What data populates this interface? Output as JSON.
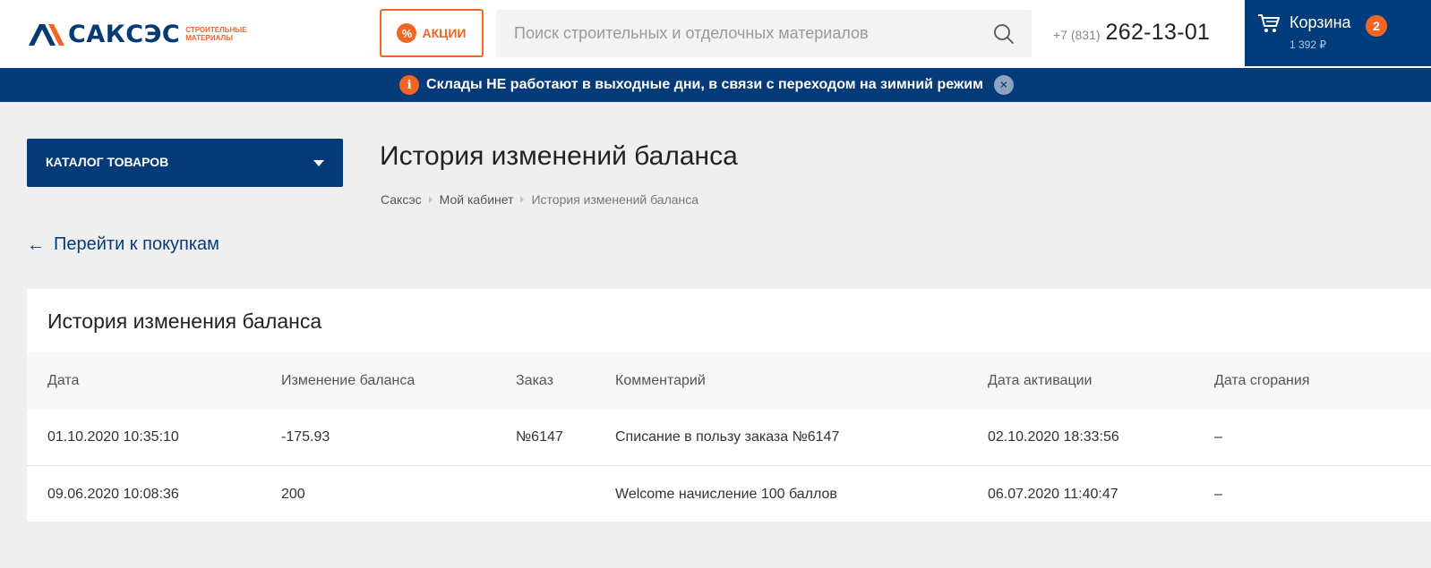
{
  "header": {
    "logo_text": "САКСЭС",
    "logo_sub_line1": "СТРОИТЕЛЬНЫЕ",
    "logo_sub_line2": "МАТЕРИАЛЫ",
    "promo_label": "АКЦИИ",
    "search_placeholder": "Поиск строительных и отделочных материалов",
    "phone_code": "+7 (831)",
    "phone_number": "262-13-01",
    "cart_label": "Корзина",
    "cart_count": "2",
    "cart_sum": "1 392 ₽"
  },
  "notice": {
    "text": "Склады НЕ работают в выходные дни, в связи с переходом на зимний режим"
  },
  "catalog_label": "КАТАЛОГ ТОВАРОВ",
  "page": {
    "title": "История изменений баланса",
    "breadcrumb": [
      "Саксэс",
      "Мой кабинет",
      "История изменений баланса"
    ],
    "back_link": "Перейти к покупкам"
  },
  "table": {
    "title": "История изменения баланса",
    "columns": [
      "Дата",
      "Изменение баланса",
      "Заказ",
      "Комментарий",
      "Дата активации",
      "Дата сгорания"
    ],
    "rows": [
      [
        "01.10.2020 10:35:10",
        "-175.93",
        "№6147",
        "Списание в пользу заказа №6147",
        "02.10.2020 18:33:56",
        "–"
      ],
      [
        "09.06.2020 10:08:36",
        "200",
        "",
        "Welcome начисление 100 баллов",
        "06.07.2020 11:40:47",
        "–"
      ]
    ]
  },
  "colors": {
    "brand_blue": "#063b7a",
    "brand_orange": "#f26522",
    "background": "#efefef"
  }
}
